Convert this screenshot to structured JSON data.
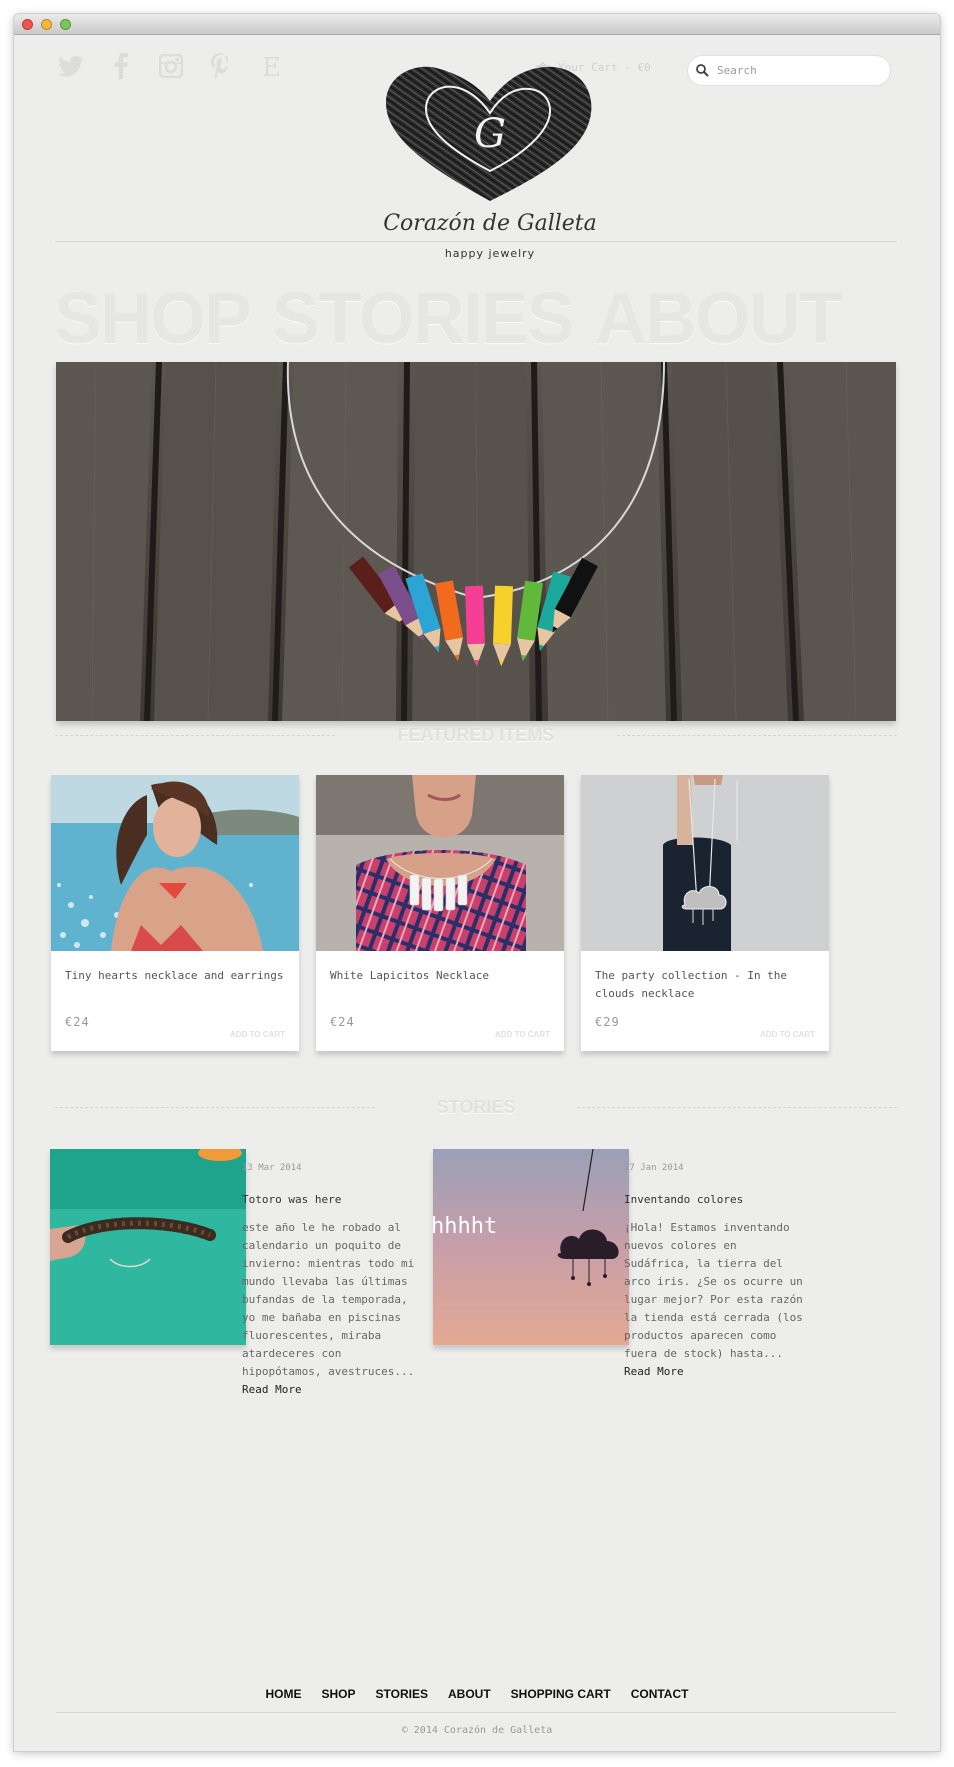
{
  "header": {
    "social": [
      {
        "icon": "twitter-icon"
      },
      {
        "icon": "facebook-icon"
      },
      {
        "icon": "instagram-icon"
      },
      {
        "icon": "pinterest-icon"
      },
      {
        "icon": "etsy-icon"
      }
    ],
    "cart_label": "Your Cart - €0",
    "search_placeholder": "Search",
    "logo_name": "Corazón de Galleta",
    "logo_tagline": "happy jewelry",
    "logo_letter": "G"
  },
  "nav": {
    "shop": "SHOP",
    "stories": "STORIES",
    "about": "ABOUT"
  },
  "featured": {
    "title": "FEATURED ITEMS",
    "items": [
      {
        "name": "Tiny hearts necklace and earrings",
        "price": "€24",
        "add": "ADD TO CART"
      },
      {
        "name": "White Lapicitos Necklace",
        "price": "€24",
        "add": "ADD TO CART"
      },
      {
        "name": "The party collection - In the clouds necklace",
        "price": "€29",
        "add": "ADD TO CART"
      }
    ]
  },
  "stories": {
    "title": "STORIES",
    "posts": [
      {
        "date": "13 Mar 2014",
        "title": "Totoro was here",
        "excerpt": "este año le he robado al calendario un poquito de invierno: mientras todo mi mundo llevaba las últimas bufandas de la temporada, yo me bañaba en piscinas fluorescentes, miraba atardeceres con hipopótamos, avestruces...",
        "read_more": "Read More"
      },
      {
        "date": "27 Jan 2014",
        "title": "Inventando colores",
        "excerpt": "¡Hola! Estamos inventando nuevos colores en Sudáfrica, la tierra del arco iris. ¿Se os ocurre un lugar mejor? Por esta razón la tienda está cerrada (los productos aparecen como fuera de stock) hasta...",
        "read_more": "Read More",
        "image_text": "hhhht"
      }
    ]
  },
  "footer": {
    "links": [
      "HOME",
      "SHOP",
      "STORIES",
      "ABOUT",
      "SHOPPING CART",
      "CONTACT"
    ],
    "copyright": "© 2014 Corazón de Galleta"
  }
}
